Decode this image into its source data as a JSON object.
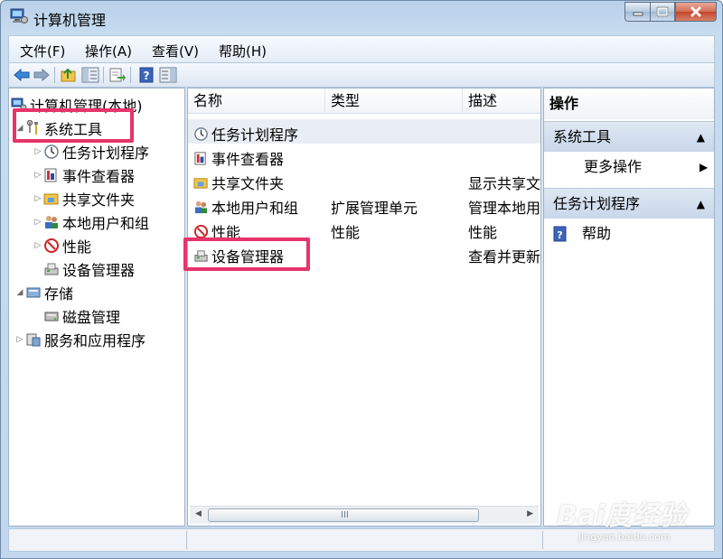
{
  "window": {
    "title": "计算机管理",
    "minimize_icon": "minimize-icon",
    "maximize_icon": "maximize-icon",
    "close_icon": "close-icon"
  },
  "menu": [
    "文件(F)",
    "操作(A)",
    "查看(V)",
    "帮助(H)"
  ],
  "toolbar": [
    "back-arrow-icon",
    "forward-arrow-icon",
    "up-folder-icon",
    "show-hide-tree-icon",
    "export-list-icon",
    "help-icon",
    "show-hide-action-pane-icon"
  ],
  "tree": {
    "root": "计算机管理(本地)",
    "items": [
      {
        "label": "系统工具",
        "level": 1,
        "expanded": true,
        "icon": "tools-icon"
      },
      {
        "label": "任务计划程序",
        "level": 2,
        "icon": "clock-icon"
      },
      {
        "label": "事件查看器",
        "level": 2,
        "icon": "event-viewer-icon"
      },
      {
        "label": "共享文件夹",
        "level": 2,
        "icon": "shared-folder-icon"
      },
      {
        "label": "本地用户和组",
        "level": 2,
        "icon": "users-icon"
      },
      {
        "label": "性能",
        "level": 2,
        "icon": "performance-icon"
      },
      {
        "label": "设备管理器",
        "level": 2,
        "icon": "device-manager-icon"
      },
      {
        "label": "存储",
        "level": 1,
        "expanded": true,
        "icon": "storage-icon"
      },
      {
        "label": "磁盘管理",
        "level": 2,
        "icon": "disk-icon"
      },
      {
        "label": "服务和应用程序",
        "level": 1,
        "expanded": false,
        "icon": "services-icon"
      }
    ]
  },
  "list": {
    "columns": [
      "名称",
      "类型",
      "描述"
    ],
    "rows": [
      {
        "name": "任务计划程序",
        "type": "",
        "desc": "",
        "icon": "clock-icon"
      },
      {
        "name": "事件查看器",
        "type": "",
        "desc": "",
        "icon": "event-viewer-icon"
      },
      {
        "name": "共享文件夹",
        "type": "",
        "desc": "显示共享文",
        "icon": "shared-folder-icon"
      },
      {
        "name": "本地用户和组",
        "type": "扩展管理单元",
        "desc": "管理本地用",
        "icon": "users-icon"
      },
      {
        "name": "性能",
        "type": "性能",
        "desc": "性能",
        "icon": "performance-icon"
      },
      {
        "name": "设备管理器",
        "type": "",
        "desc": "查看并更新",
        "icon": "device-manager-icon"
      }
    ],
    "scroll_grip": "III"
  },
  "actions": {
    "title": "操作",
    "sections": [
      {
        "header": "系统工具",
        "items": [
          {
            "label": "更多操作",
            "has_submenu": true
          }
        ]
      },
      {
        "header": "任务计划程序",
        "items": [
          {
            "label": "帮助",
            "icon": "help-icon"
          }
        ]
      }
    ]
  },
  "watermark": {
    "brand": "Bai度经验",
    "url": "jingyan.baidu.com"
  },
  "colors": {
    "highlight": "#e8336b",
    "selected_row": "#e9eef4",
    "action_header": "#c8d7ea"
  }
}
